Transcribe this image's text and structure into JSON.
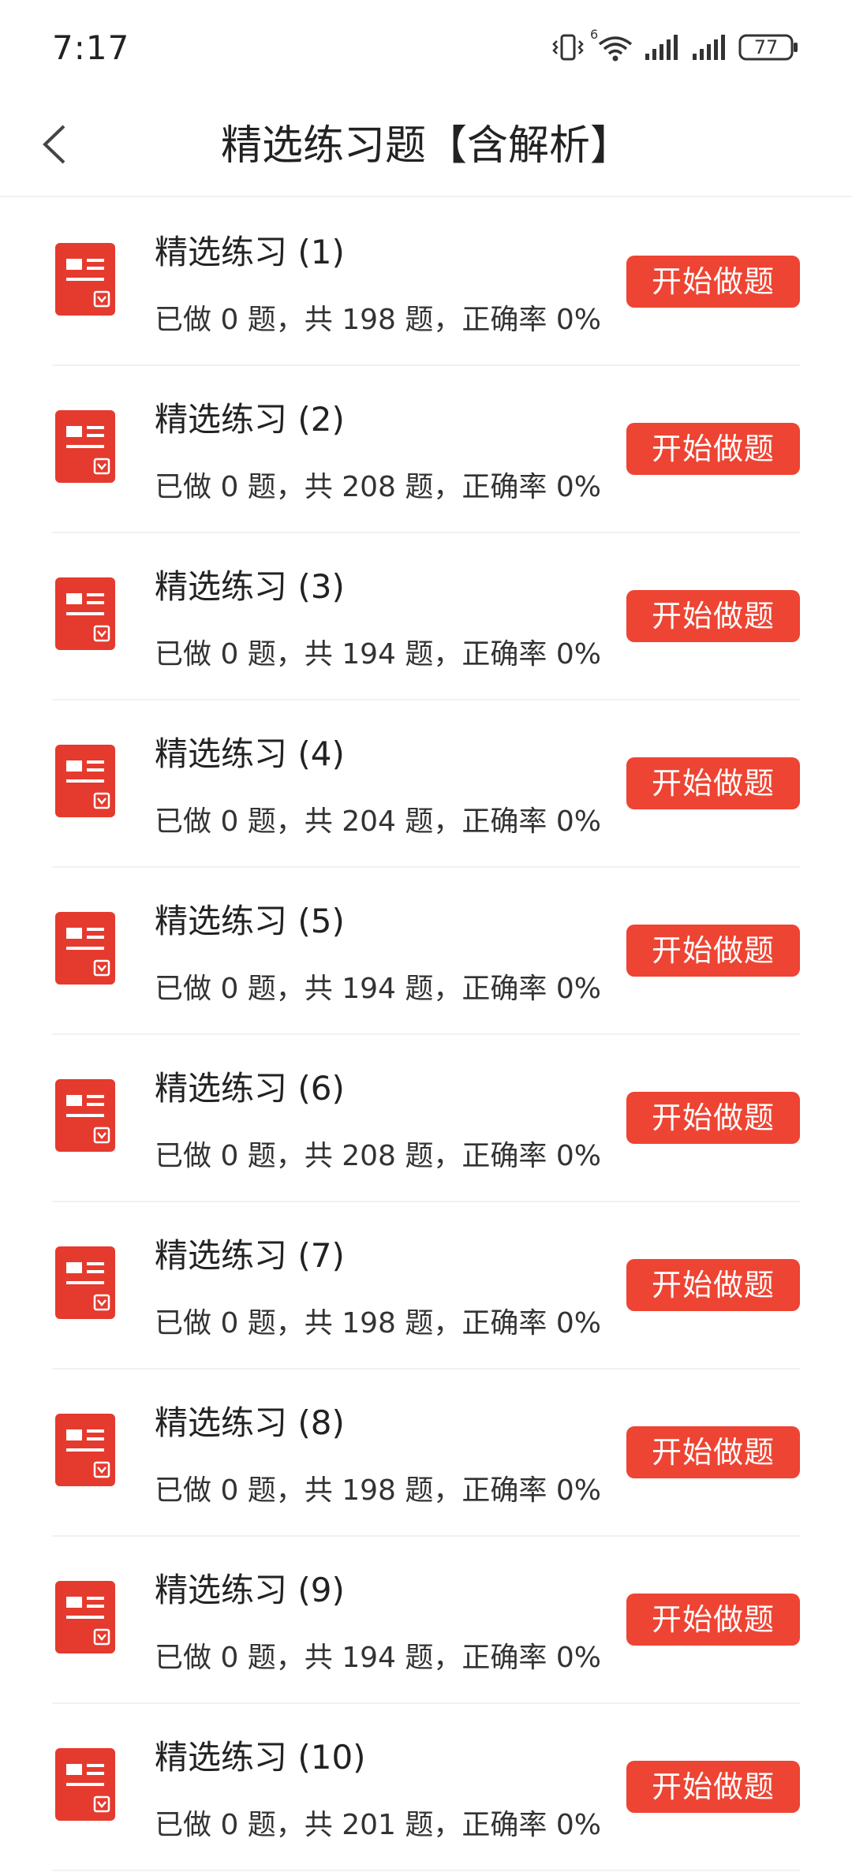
{
  "status": {
    "time": "7:17",
    "battery": "77",
    "wifi_label": "6"
  },
  "header": {
    "title": "精选练习题【含解析】"
  },
  "colors": {
    "accent": "#ee4433",
    "icon": "#e53a2e"
  },
  "items": [
    {
      "title": "精选练习 (1)",
      "stats": "已做 0 题，共 198 题，正确率 0%",
      "button": "开始做题"
    },
    {
      "title": "精选练习 (2)",
      "stats": "已做 0 题，共 208 题，正确率 0%",
      "button": "开始做题"
    },
    {
      "title": "精选练习 (3)",
      "stats": "已做 0 题，共 194 题，正确率 0%",
      "button": "开始做题"
    },
    {
      "title": "精选练习 (4)",
      "stats": "已做 0 题，共 204 题，正确率 0%",
      "button": "开始做题"
    },
    {
      "title": "精选练习 (5)",
      "stats": "已做 0 题，共 194 题，正确率 0%",
      "button": "开始做题"
    },
    {
      "title": "精选练习 (6)",
      "stats": "已做 0 题，共 208 题，正确率 0%",
      "button": "开始做题"
    },
    {
      "title": "精选练习 (7)",
      "stats": "已做 0 题，共 198 题，正确率 0%",
      "button": "开始做题"
    },
    {
      "title": "精选练习 (8)",
      "stats": "已做 0 题，共 198 题，正确率 0%",
      "button": "开始做题"
    },
    {
      "title": "精选练习 (9)",
      "stats": "已做 0 题，共 194 题，正确率 0%",
      "button": "开始做题"
    },
    {
      "title": "精选练习 (10)",
      "stats": "已做 0 题，共 201 题，正确率 0%",
      "button": "开始做题"
    }
  ]
}
